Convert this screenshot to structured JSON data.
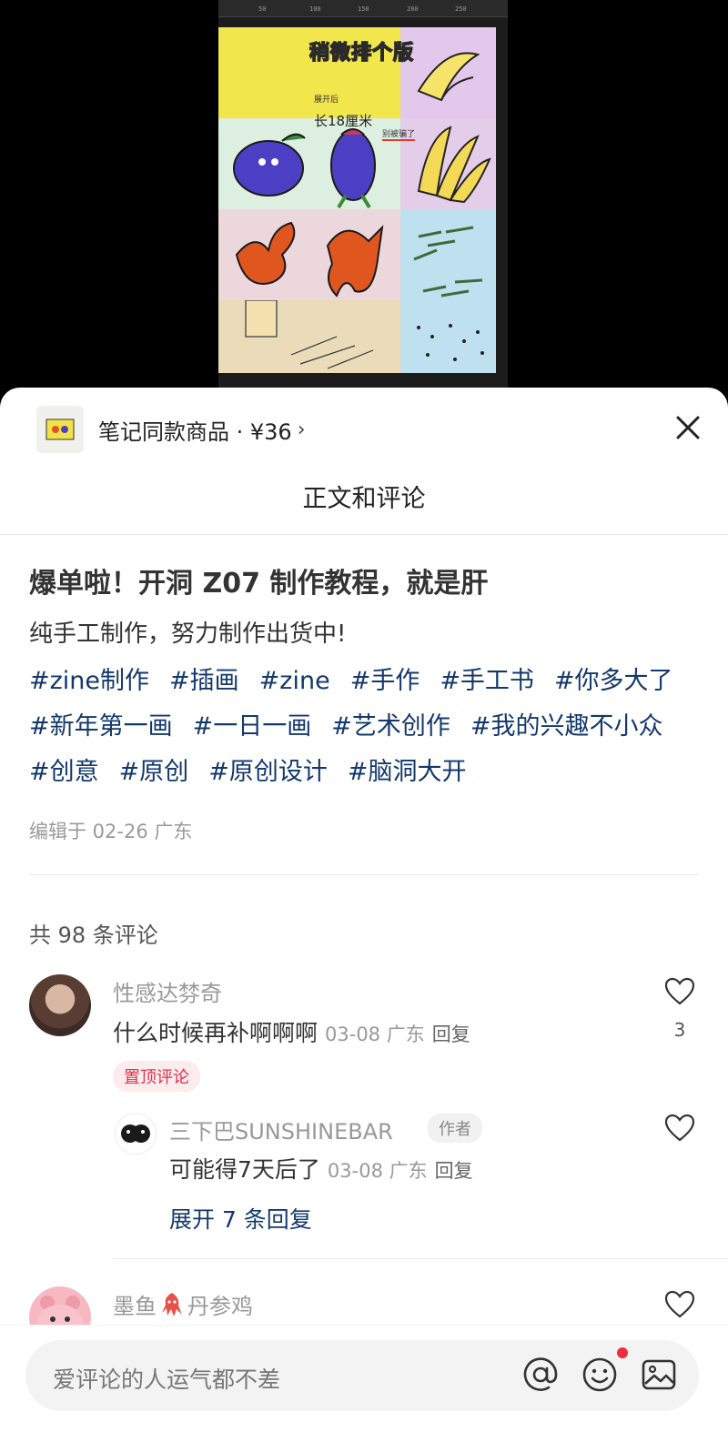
{
  "media": {
    "ruler_ticks": [
      "50",
      "100",
      "150",
      "200",
      "250"
    ],
    "poster_title": "稍微排个版",
    "poster_small": "展开后",
    "poster_big": "长18厘米",
    "poster_note": "别被骗了"
  },
  "product": {
    "label": "笔记同款商品 · ¥36",
    "arrow": "›"
  },
  "sheet": {
    "title": "正文和评论"
  },
  "note": {
    "title": "爆单啦！开洞 Z07 制作教程，就是肝",
    "body": "纯手工制作，努力制作出货中!",
    "tags": [
      "#zine制作",
      "#插画",
      "#zine",
      "#手作",
      "#手工书",
      "#你多大了",
      "#新年第一画",
      "#一日一画",
      "#艺术创作",
      "#我的兴趣不小众",
      "#创意",
      "#原创",
      "#原创设计",
      "#脑洞大开"
    ],
    "edit_meta": "编辑于 02-26 广东"
  },
  "comments": {
    "count_label": "共 98 条评论",
    "items": [
      {
        "name": "性感达棼奇",
        "text": "什么时候再补啊啊啊",
        "date": "03-08 广东",
        "reply": "回复",
        "likes": "3",
        "pin_badge": "置顶评论"
      },
      {
        "name": "三下巴SUNSHINEBAR",
        "author_badge": "作者",
        "text": "可能得7天后了",
        "date": "03-08 广东",
        "reply": "回复"
      },
      {
        "name_prefix": "墨鱼",
        "name_suffix": "丹参鸡"
      }
    ],
    "expand_label": "展开 7 条回复"
  },
  "input": {
    "placeholder": "爱评论的人运气都不差"
  },
  "colors": {
    "tag_blue": "#13386c",
    "pin_red": "#e0304b",
    "notification_dot": "#ef2b3d"
  },
  "icons": [
    "close-icon",
    "heart-icon",
    "at-icon",
    "emoji-icon",
    "image-icon",
    "squid-emoji-icon"
  ]
}
